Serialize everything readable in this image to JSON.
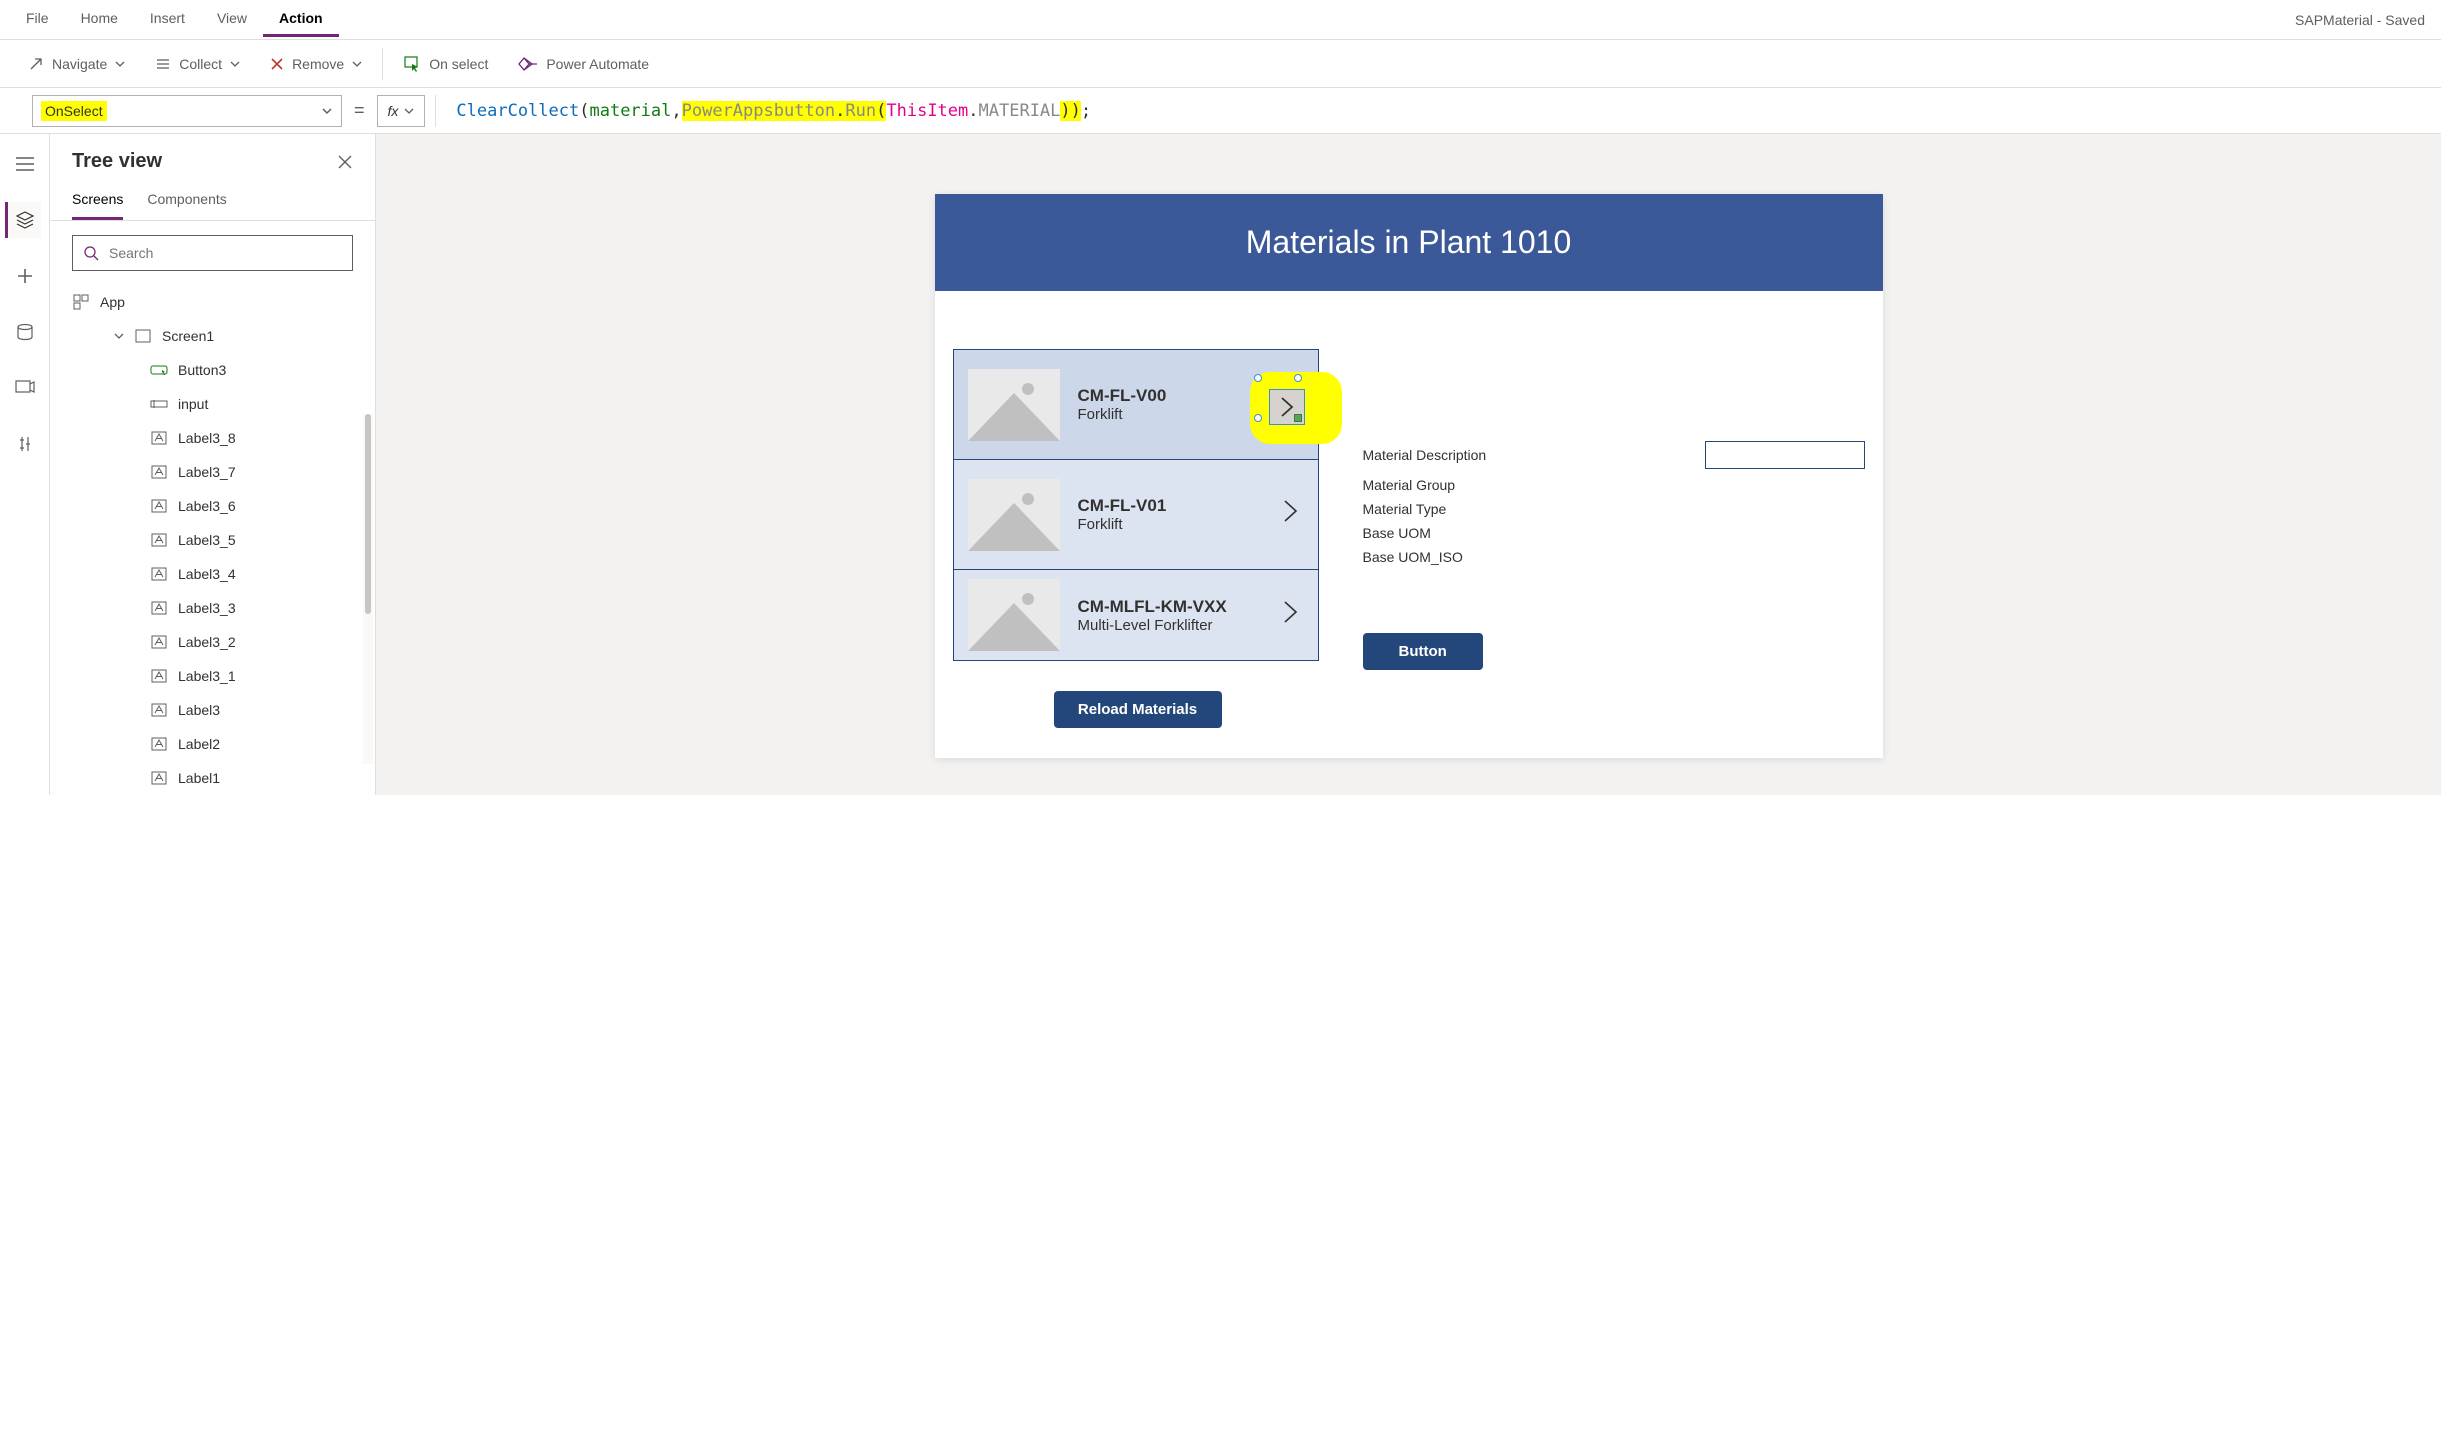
{
  "window": {
    "title": "SAPMaterial - Saved"
  },
  "menubar": [
    "File",
    "Home",
    "Insert",
    "View",
    "Action"
  ],
  "menubar_active": "Action",
  "ribbon": {
    "navigate": "Navigate",
    "collect": "Collect",
    "remove": "Remove",
    "onselect": "On select",
    "pa": "Power Automate"
  },
  "property_selector": "OnSelect",
  "formula": {
    "func": "ClearCollect",
    "var": "material",
    "obj": "PowerAppsbutton",
    "meth": "Run",
    "ctx": "ThisItem",
    "prop": "MATERIAL"
  },
  "tree": {
    "title": "Tree view",
    "tabs": [
      "Screens",
      "Components"
    ],
    "tabs_active": "Screens",
    "search_placeholder": "Search",
    "root": "App",
    "screen": "Screen1",
    "items": [
      "Button3",
      "input",
      "Label3_8",
      "Label3_7",
      "Label3_6",
      "Label3_5",
      "Label3_4",
      "Label3_3",
      "Label3_2",
      "Label3_1",
      "Label3",
      "Label2",
      "Label1"
    ]
  },
  "app": {
    "header": "Materials in Plant 1010",
    "gallery": [
      {
        "title": "CM-FL-V00",
        "sub": "Forklift"
      },
      {
        "title": "CM-FL-V01",
        "sub": "Forklift"
      },
      {
        "title": "CM-MLFL-KM-VXX",
        "sub": "Multi-Level Forklifter"
      }
    ],
    "fields": [
      "Material Description",
      "Material Group",
      "Material Type",
      "Base UOM",
      "Base UOM_ISO"
    ],
    "reload_label": "Reload Materials",
    "button_label": "Button"
  }
}
